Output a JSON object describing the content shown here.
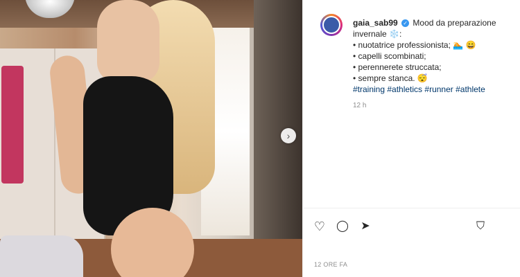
{
  "post": {
    "username": "gaia_sab99",
    "verified_icon": "verified-badge-icon",
    "caption_lines": [
      "Mood da preparazione",
      "invernale ❄️:",
      "• nuotatrice professionista; 🏊 😄",
      "• capelli scombinati;",
      "• perennerete struccata;",
      "• sempre stanca. 😴"
    ],
    "hashtags": "#training #athletics #runner #athlete",
    "caption_time": "12 h",
    "posted_ago": "12 ORE FA"
  },
  "actions": {
    "like_icon": "♡",
    "comment_icon": "◯",
    "share_icon": "➤",
    "save_icon": "⛉"
  },
  "carousel": {
    "next_icon": "›"
  }
}
